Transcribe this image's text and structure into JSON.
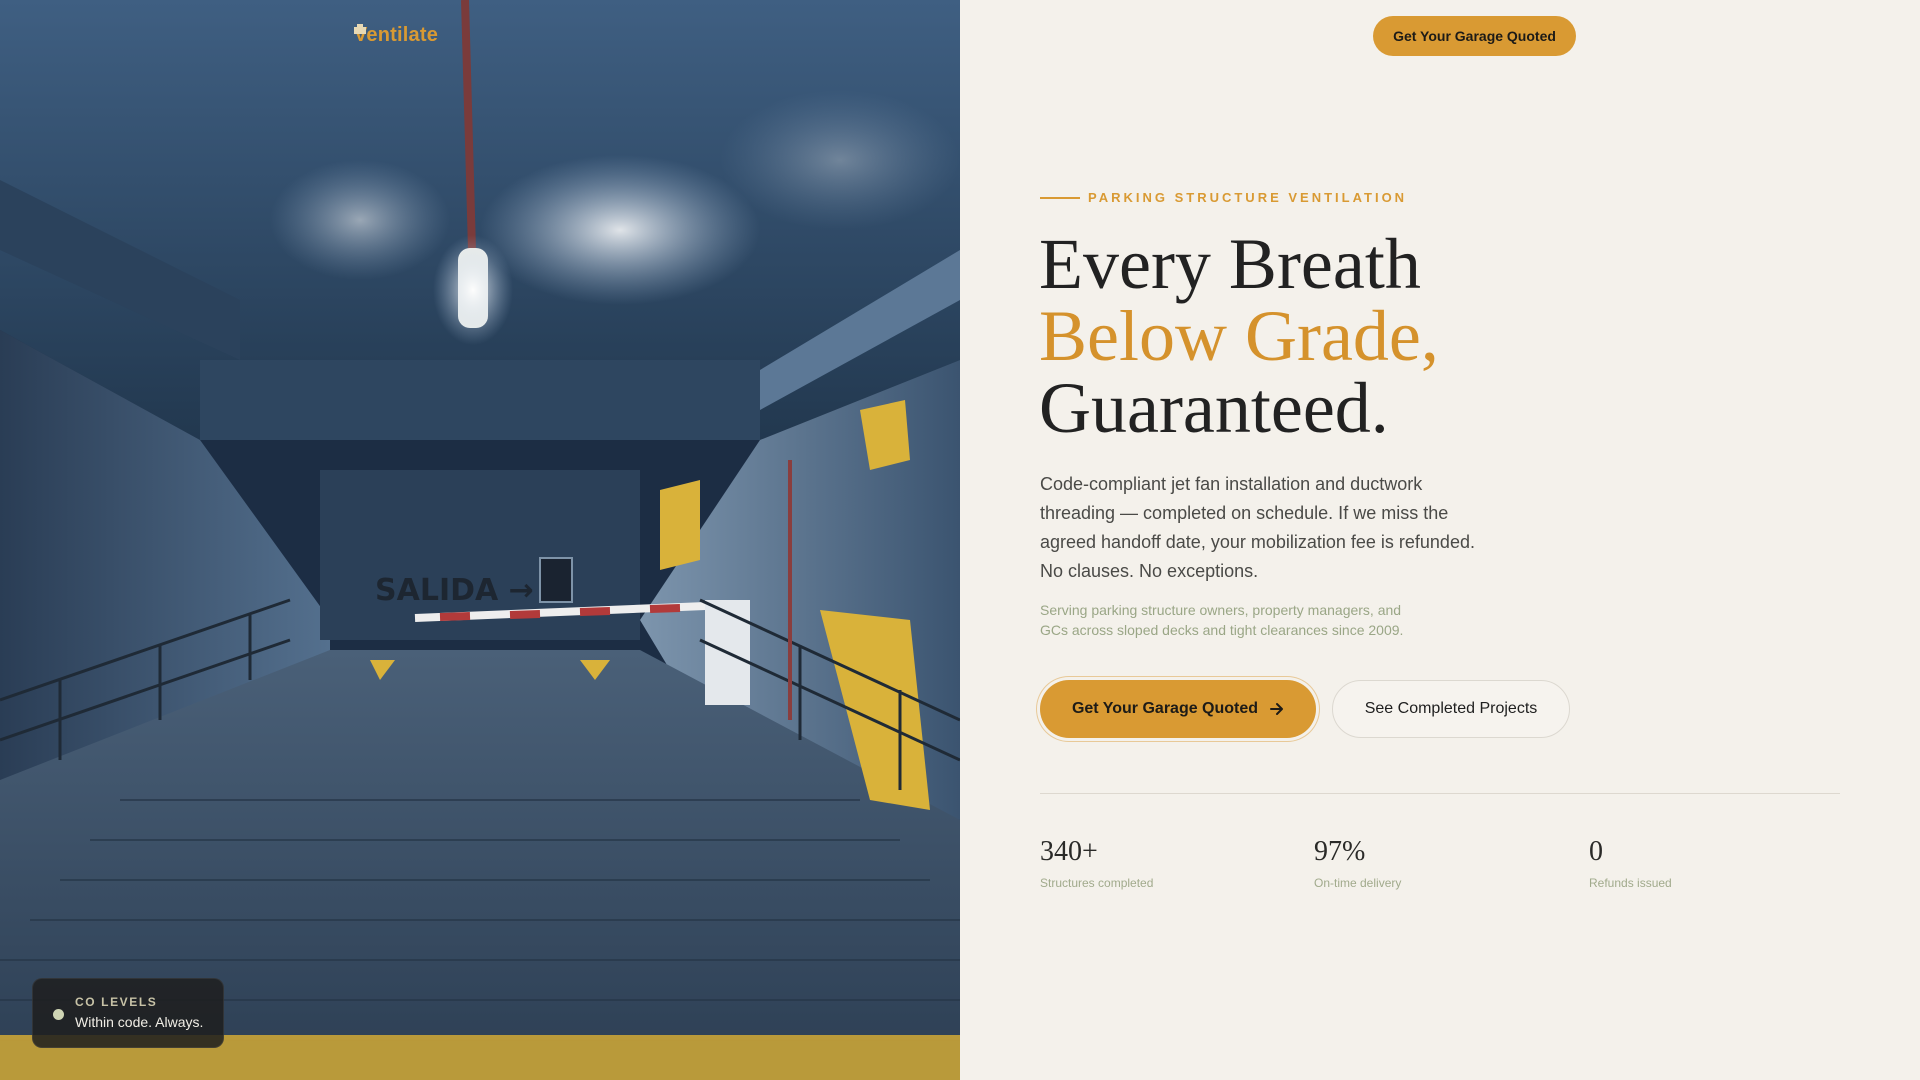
{
  "brand": {
    "name": "Ventilate",
    "icon": "building-icon"
  },
  "header": {
    "cta_label": "Get Your Garage Quoted"
  },
  "hero": {
    "eyebrow": "PARKING STRUCTURE VENTILATION",
    "headline_line1": "Every Breath",
    "headline_line2": "Below Grade,",
    "headline_line3": "Guaranteed.",
    "lead": "Code-compliant jet fan installation and ductwork threading — completed on schedule. If we miss the agreed handoff date, your mobilization fee is refunded. No clauses. No exceptions.",
    "sub": "Serving parking structure owners, property managers, and GCs across sloped decks and tight clearances since 2009.",
    "primary_cta": "Get Your Garage Quoted",
    "primary_cta_icon": "arrow-right-icon",
    "secondary_cta": "See Completed Projects"
  },
  "stats": [
    {
      "value": "340+",
      "label": "Structures completed"
    },
    {
      "value": "97%",
      "label": "On-time delivery"
    },
    {
      "value": "0",
      "label": "Refunds issued"
    }
  ],
  "photo": {
    "sign_text": "SALIDA →"
  },
  "status_card": {
    "label": "CO LEVELS",
    "value": "Within code. Always."
  },
  "colors": {
    "accent": "#d99a33",
    "background": "#f4f1eb",
    "text": "#222222",
    "muted_green": "#9aa686"
  }
}
